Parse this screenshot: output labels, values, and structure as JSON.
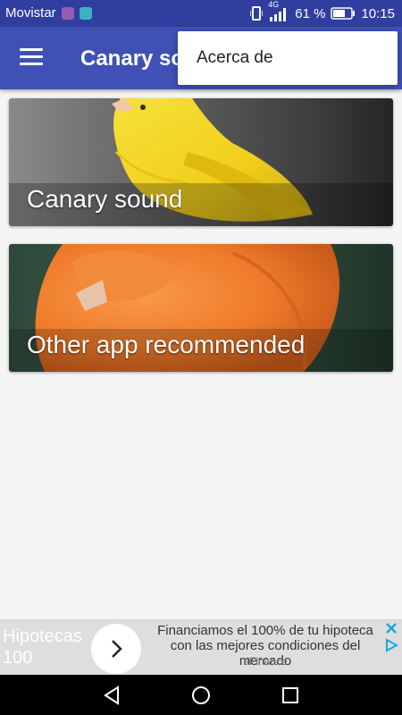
{
  "status_bar": {
    "carrier": "Movistar",
    "network": "4G",
    "battery": "61 %",
    "time": "10:15"
  },
  "app_bar": {
    "title": "Canary so"
  },
  "overflow_menu": {
    "items": [
      "Acerca de"
    ]
  },
  "cards": [
    {
      "label": "Canary sound"
    },
    {
      "label": "Other app recommended"
    }
  ],
  "ad": {
    "headline": "Hipotecas 100",
    "body": "Financiamos el 100% de tu hipoteca con las mejores condiciones del mercado",
    "source": "aFinance"
  },
  "colors": {
    "status_bar": "#303f9f",
    "app_bar": "#3f51b5",
    "background": "#f5f5f5"
  },
  "icons": {
    "menu": "hamburger-icon",
    "nav": [
      "back-icon",
      "home-icon",
      "recents-icon"
    ]
  }
}
